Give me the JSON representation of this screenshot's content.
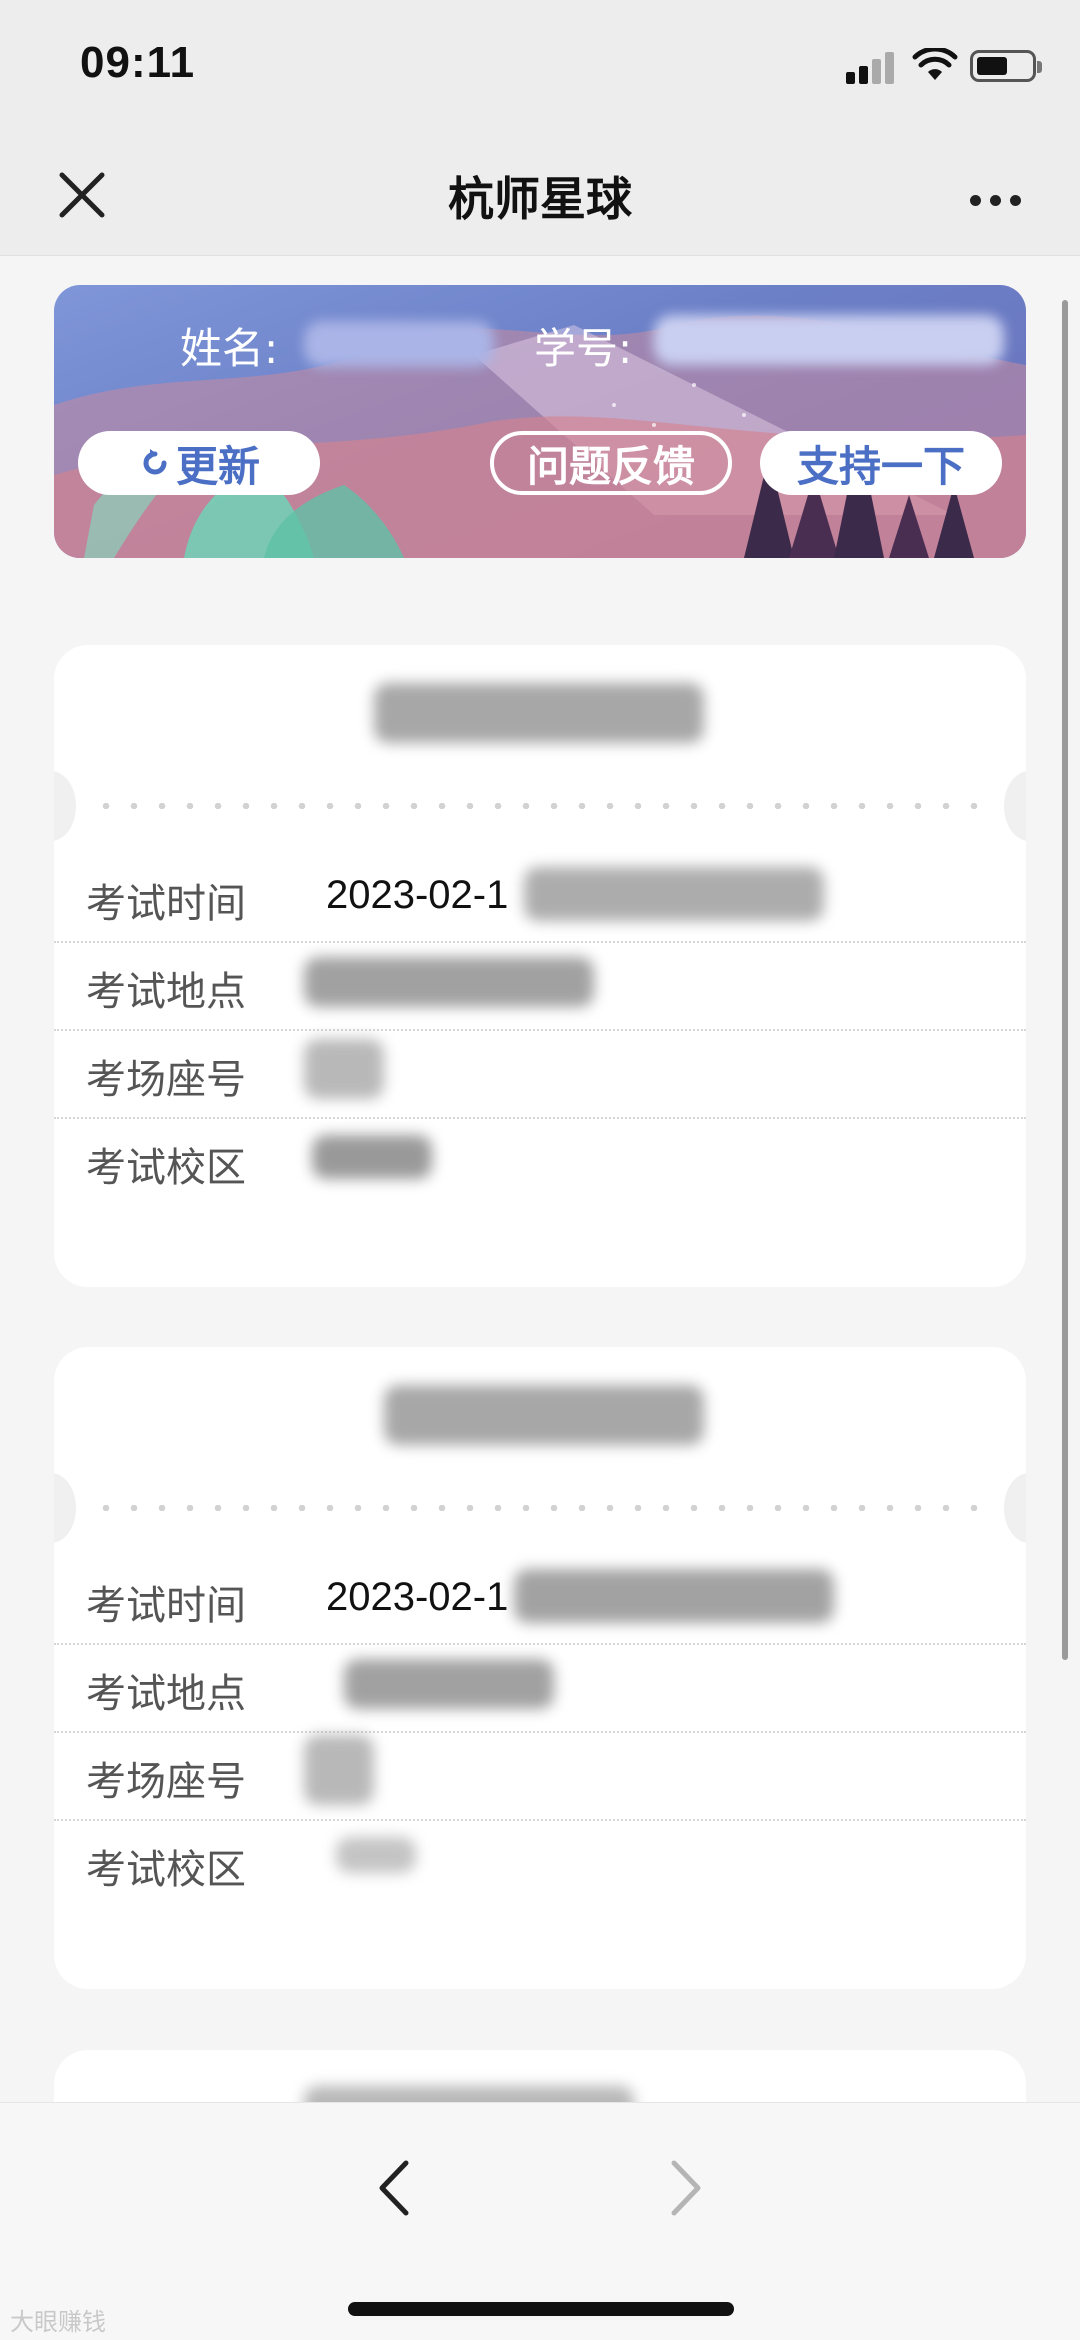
{
  "status_bar": {
    "time": "09:11"
  },
  "nav": {
    "title": "杭师星球"
  },
  "banner": {
    "name_label": "姓名:",
    "student_id_label": "学号:",
    "refresh_label": "更新",
    "refresh_icon": "refresh-icon",
    "feedback_label": "问题反馈",
    "support_label": "支持一下"
  },
  "exams": [
    {
      "rows": [
        {
          "key": "考试时间",
          "value": "2023-02-1"
        },
        {
          "key": "考试地点",
          "value": ""
        },
        {
          "key": "考场座号",
          "value": ""
        },
        {
          "key": "考试校区",
          "value": ""
        }
      ]
    },
    {
      "rows": [
        {
          "key": "考试时间",
          "value": "2023-02-1"
        },
        {
          "key": "考试地点",
          "value": ""
        },
        {
          "key": "考场座号",
          "value": ""
        },
        {
          "key": "考试校区",
          "value": ""
        }
      ]
    }
  ],
  "watermark": "大眼赚钱"
}
